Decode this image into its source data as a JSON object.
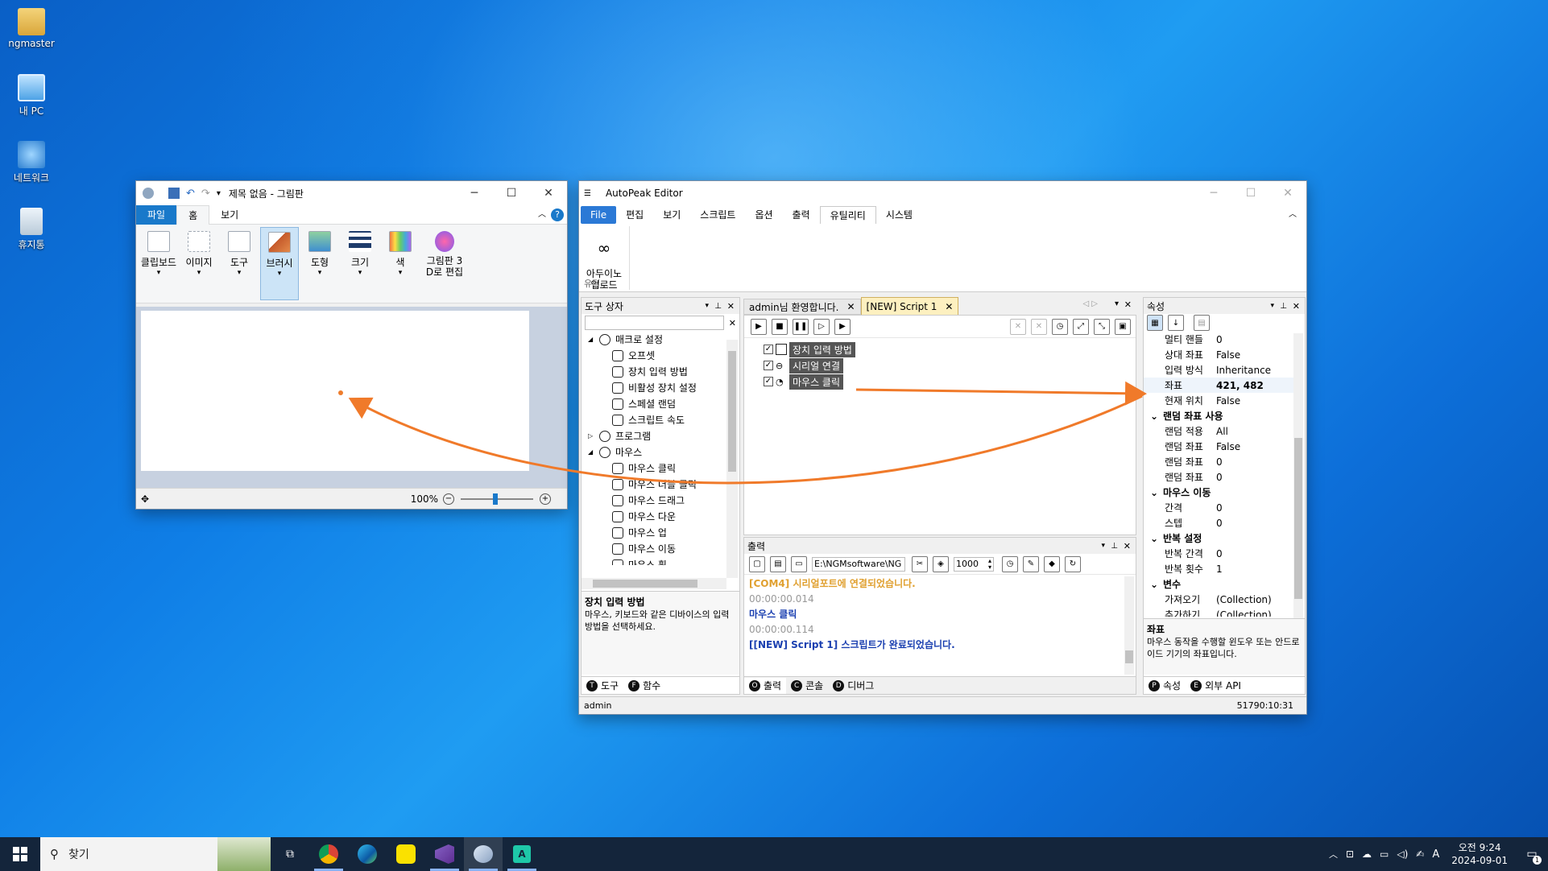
{
  "desktop": {
    "icons": [
      {
        "label": "ngmaster"
      },
      {
        "label": "내 PC"
      },
      {
        "label": "네트워크"
      },
      {
        "label": "휴지통"
      }
    ]
  },
  "paint": {
    "title": "제목 없음 - 그림판",
    "tabs": [
      "파일",
      "홈",
      "보기"
    ],
    "ribbon": [
      "클립보드",
      "이미지",
      "도구",
      "브러시",
      "도형",
      "크기",
      "색",
      "그림판 3\nD로 편집"
    ],
    "zoom": "100%"
  },
  "editor": {
    "title": "AutoPeak Editor",
    "menu": [
      "File",
      "편집",
      "보기",
      "스크립트",
      "옵션",
      "출력",
      "유틸리티",
      "시스템"
    ],
    "ribbon_button": "아두이노\n업로드",
    "ribbon_group": "유틸...",
    "toolbox": {
      "title": "도구 상자",
      "items": [
        {
          "label": "매크로 설정",
          "level": 0,
          "exp": "◢"
        },
        {
          "label": "오프셋",
          "level": 1
        },
        {
          "label": "장치 입력 방법",
          "level": 1
        },
        {
          "label": "비활성 장치 설정",
          "level": 1
        },
        {
          "label": "스페셜 랜덤",
          "level": 1
        },
        {
          "label": "스크립트 속도",
          "level": 1
        },
        {
          "label": "프로그램",
          "level": 0,
          "exp": "▷"
        },
        {
          "label": "마우스",
          "level": 0,
          "exp": "◢"
        },
        {
          "label": "마우스 클릭",
          "level": 1
        },
        {
          "label": "마우스 더블 클릭",
          "level": 1
        },
        {
          "label": "마우스 드래그",
          "level": 1
        },
        {
          "label": "마우스 다운",
          "level": 1
        },
        {
          "label": "마우스 업",
          "level": 1
        },
        {
          "label": "마우스 이동",
          "level": 1
        },
        {
          "label": "마우스 휠",
          "level": 1
        }
      ],
      "desc_title": "장치 입력 방법",
      "desc_text": "마우스, 키보드와 같은 디바이스의 입력 방법을 선택하세요.",
      "bottom_tabs": [
        {
          "key": "T",
          "label": "도구"
        },
        {
          "key": "F",
          "label": "함수"
        }
      ]
    },
    "doc_tabs": [
      "admin님 환영합니다.",
      "[NEW] Script 1"
    ],
    "script_lines": [
      "장치 입력 방법",
      "시리얼 연결",
      "마우스 클릭"
    ],
    "output": {
      "title": "출력",
      "path": "E:\\NGMsoftware\\NG",
      "interval": "1000",
      "lines": [
        {
          "text": "[COM4] 시리얼포트에 연결되었습니다.",
          "color": "#e0a030"
        },
        {
          "text": "00:00:00.014",
          "color": "#999999"
        },
        {
          "text": "마우스 클릭",
          "color": "#1a3fb0"
        },
        {
          "text": "00:00:00.114",
          "color": "#999999"
        },
        {
          "text": "[[NEW] Script 1] 스크립트가 완료되었습니다.",
          "color": "#1a3fb0"
        }
      ],
      "bottom_tabs": [
        {
          "key": "O",
          "label": "출력"
        },
        {
          "key": "C",
          "label": "콘솔"
        },
        {
          "key": "D",
          "label": "디버그"
        }
      ]
    },
    "properties": {
      "title": "속성",
      "rows": [
        {
          "type": "prop",
          "k": "멀티 핸들",
          "v": "0"
        },
        {
          "type": "prop",
          "k": "상대 좌표",
          "v": "False"
        },
        {
          "type": "prop",
          "k": "입력 방식",
          "v": "Inheritance"
        },
        {
          "type": "prop",
          "k": "좌표",
          "v": "421, 482",
          "bold": true
        },
        {
          "type": "prop",
          "k": "현재 위치",
          "v": "False"
        },
        {
          "type": "cat",
          "k": "랜덤 좌표 사용"
        },
        {
          "type": "prop",
          "k": "랜덤 적용",
          "v": "All"
        },
        {
          "type": "prop",
          "k": "랜덤 좌표",
          "v": "False"
        },
        {
          "type": "prop",
          "k": "랜덤 좌표",
          "v": "0"
        },
        {
          "type": "prop",
          "k": "랜덤 좌표",
          "v": "0"
        },
        {
          "type": "cat",
          "k": "마우스 이동"
        },
        {
          "type": "prop",
          "k": "간격",
          "v": "0"
        },
        {
          "type": "prop",
          "k": "스텝",
          "v": "0"
        },
        {
          "type": "cat",
          "k": "반복 설정"
        },
        {
          "type": "prop",
          "k": "반복 간격",
          "v": "0"
        },
        {
          "type": "prop",
          "k": "반복 횟수",
          "v": "1"
        },
        {
          "type": "cat",
          "k": "변수"
        },
        {
          "type": "prop",
          "k": "가져오기",
          "v": "(Collection)"
        },
        {
          "type": "prop",
          "k": "추가하기",
          "v": "(Collection)"
        }
      ],
      "desc_title": "좌표",
      "desc_text": "마우스 동작을 수행할 윈도우 또는 안드로이드 기기의 좌표입니다.",
      "bottom_tabs": [
        {
          "key": "P",
          "label": "속성"
        },
        {
          "key": "E",
          "label": "외부 API"
        }
      ]
    },
    "status_left": "admin",
    "status_right": "51790:10:31"
  },
  "taskbar": {
    "search_placeholder": "찾기",
    "time": "오전 9:24",
    "date": "2024-09-01",
    "ime": "A",
    "notif": "1"
  },
  "colors": {
    "arrow": "#f07a2a",
    "accent": "#2b79d6"
  }
}
